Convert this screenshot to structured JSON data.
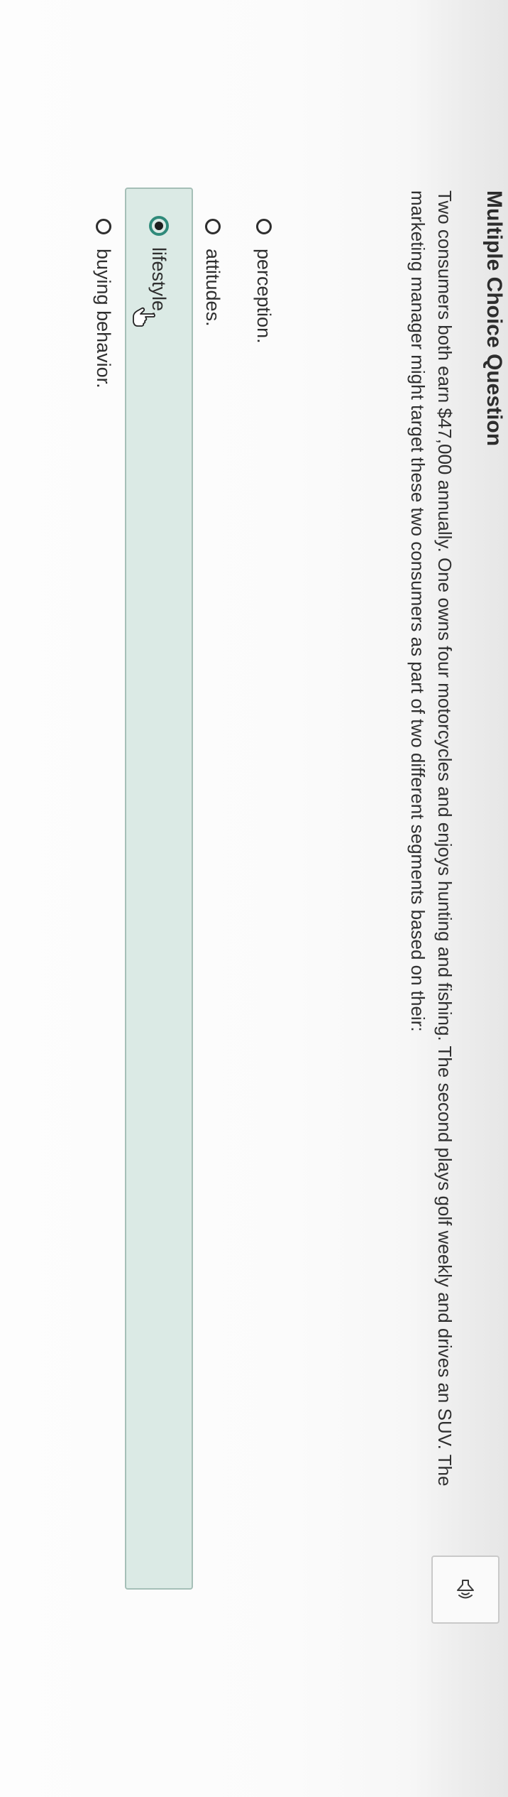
{
  "question": {
    "title": "Multiple Choice Question",
    "text_lines": [
      "Two consumers both earn $47,000 annually. One owns four motorcycles and enjoys hunting and fishing. The second plays golf weekly and drives an SUV. The",
      "marketing manager might target these two consumers as part of two different segments based on their:"
    ]
  },
  "speaker": {
    "icon": "speaker-icon"
  },
  "options": [
    {
      "label": "perception.",
      "selected": false
    },
    {
      "label": "attitudes.",
      "selected": false
    },
    {
      "label": "lifestyle.",
      "selected": true
    },
    {
      "label": "buying behavior.",
      "selected": false
    }
  ],
  "colors": {
    "selected_background": "#dbeae5",
    "selected_border": "#a5bfb7",
    "radio_selected": "#2f8a7a",
    "text": "#2f2f2f"
  },
  "cursor": {
    "icon": "hand-pointer-icon"
  }
}
